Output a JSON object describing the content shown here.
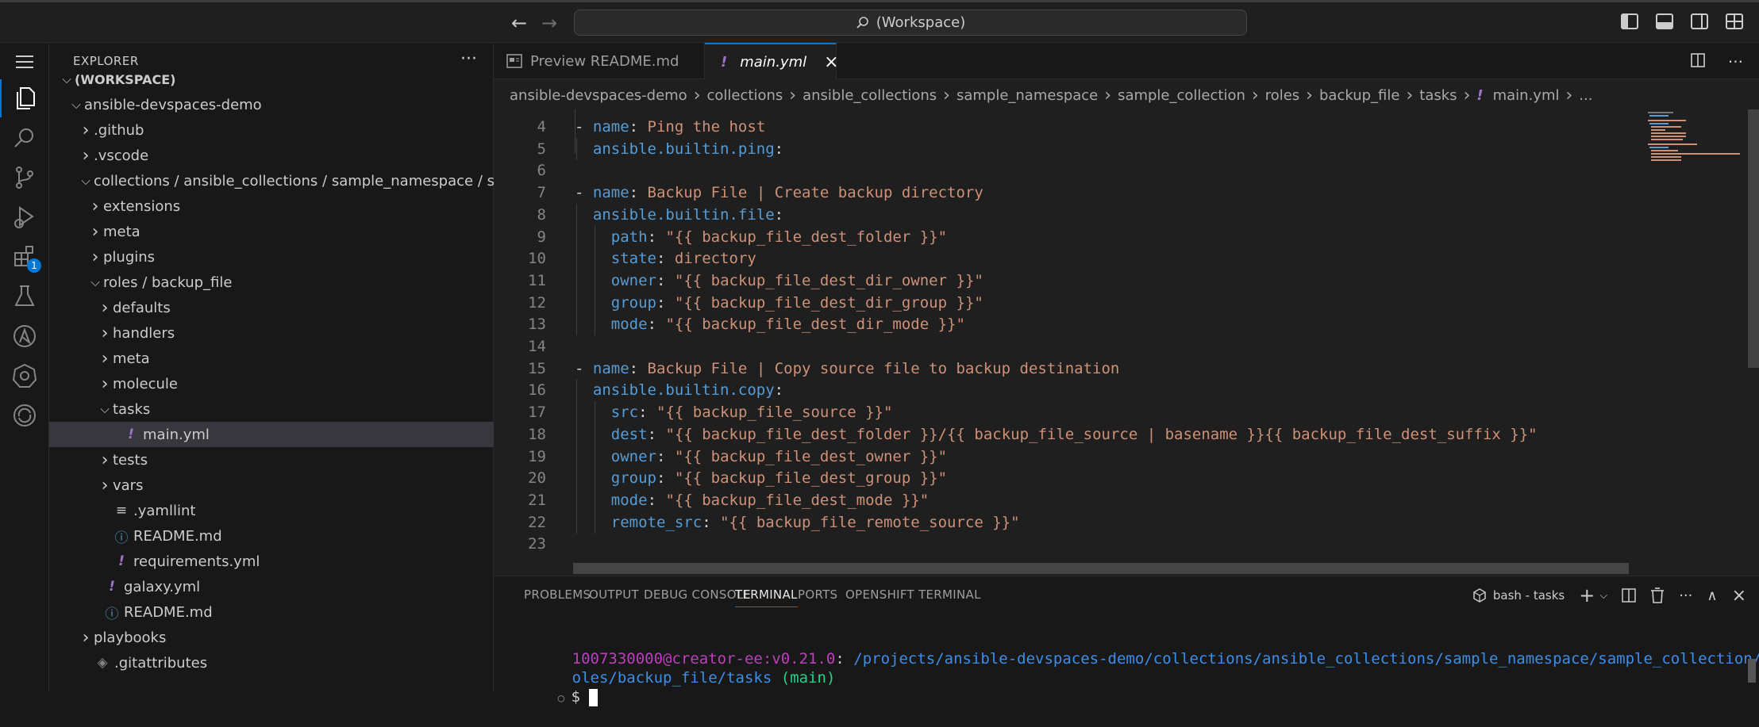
{
  "titlebar": {
    "search_label": "(Workspace)"
  },
  "activity_bar": {
    "extensions_badge": "1"
  },
  "explorer": {
    "title": "EXPLORER",
    "more": "···",
    "tree": [
      {
        "label": "(WORKSPACE)",
        "depth": 0,
        "type": "folder-open",
        "bold": true
      },
      {
        "label": "ansible-devspaces-demo",
        "depth": 1,
        "type": "folder-open"
      },
      {
        "label": ".github",
        "depth": 2,
        "type": "folder"
      },
      {
        "label": ".vscode",
        "depth": 2,
        "type": "folder"
      },
      {
        "label": "collections / ansible_collections / sample_namespace / sa...",
        "depth": 2,
        "type": "folder-open"
      },
      {
        "label": "extensions",
        "depth": 3,
        "type": "folder"
      },
      {
        "label": "meta",
        "depth": 3,
        "type": "folder"
      },
      {
        "label": "plugins",
        "depth": 3,
        "type": "folder"
      },
      {
        "label": "roles / backup_file",
        "depth": 3,
        "type": "folder-open"
      },
      {
        "label": "defaults",
        "depth": 4,
        "type": "folder"
      },
      {
        "label": "handlers",
        "depth": 4,
        "type": "folder"
      },
      {
        "label": "meta",
        "depth": 4,
        "type": "folder"
      },
      {
        "label": "molecule",
        "depth": 4,
        "type": "folder"
      },
      {
        "label": "tasks",
        "depth": 4,
        "type": "folder-open"
      },
      {
        "label": "main.yml",
        "depth": 5,
        "type": "yaml",
        "selected": true
      },
      {
        "label": "tests",
        "depth": 4,
        "type": "folder"
      },
      {
        "label": "vars",
        "depth": 4,
        "type": "folder"
      },
      {
        "label": ".yamllint",
        "depth": 4,
        "type": "lines"
      },
      {
        "label": "README.md",
        "depth": 4,
        "type": "info"
      },
      {
        "label": "requirements.yml",
        "depth": 4,
        "type": "yaml"
      },
      {
        "label": "galaxy.yml",
        "depth": 3,
        "type": "yaml"
      },
      {
        "label": "README.md",
        "depth": 3,
        "type": "info"
      },
      {
        "label": "playbooks",
        "depth": 2,
        "type": "folder"
      },
      {
        "label": ".gitattributes",
        "depth": 2,
        "type": "git"
      }
    ]
  },
  "tabs": [
    {
      "label": "Preview README.md",
      "active": false
    },
    {
      "label": "main.yml",
      "active": true,
      "close": "×"
    }
  ],
  "breadcrumb": [
    "ansible-devspaces-demo",
    "collections",
    "ansible_collections",
    "sample_namespace",
    "sample_collection",
    "roles",
    "backup_file",
    "tasks",
    "main.yml",
    "..."
  ],
  "code": [
    {
      "n": "4",
      "indent": 0,
      "parts": [
        [
          "d",
          "- "
        ],
        [
          "k",
          "name"
        ],
        [
          "d",
          ": "
        ],
        [
          "s",
          "Ping the host"
        ]
      ]
    },
    {
      "n": "5",
      "indent": 1,
      "parts": [
        [
          "k",
          "ansible.builtin.ping"
        ],
        [
          "d",
          ":"
        ]
      ]
    },
    {
      "n": "6",
      "indent": 0,
      "parts": []
    },
    {
      "n": "7",
      "indent": 0,
      "parts": [
        [
          "d",
          "- "
        ],
        [
          "k",
          "name"
        ],
        [
          "d",
          ": "
        ],
        [
          "s",
          "Backup File | Create backup directory"
        ]
      ]
    },
    {
      "n": "8",
      "indent": 1,
      "parts": [
        [
          "k",
          "ansible.builtin.file"
        ],
        [
          "d",
          ":"
        ]
      ]
    },
    {
      "n": "9",
      "indent": 2,
      "parts": [
        [
          "k",
          "path"
        ],
        [
          "d",
          ": "
        ],
        [
          "s",
          "\"{{ backup_file_dest_folder }}\""
        ]
      ]
    },
    {
      "n": "10",
      "indent": 2,
      "parts": [
        [
          "k",
          "state"
        ],
        [
          "d",
          ": "
        ],
        [
          "s",
          "directory"
        ]
      ]
    },
    {
      "n": "11",
      "indent": 2,
      "parts": [
        [
          "k",
          "owner"
        ],
        [
          "d",
          ": "
        ],
        [
          "s",
          "\"{{ backup_file_dest_dir_owner }}\""
        ]
      ]
    },
    {
      "n": "12",
      "indent": 2,
      "parts": [
        [
          "k",
          "group"
        ],
        [
          "d",
          ": "
        ],
        [
          "s",
          "\"{{ backup_file_dest_dir_group }}\""
        ]
      ]
    },
    {
      "n": "13",
      "indent": 2,
      "parts": [
        [
          "k",
          "mode"
        ],
        [
          "d",
          ": "
        ],
        [
          "s",
          "\"{{ backup_file_dest_dir_mode }}\""
        ]
      ]
    },
    {
      "n": "14",
      "indent": 0,
      "parts": []
    },
    {
      "n": "15",
      "indent": 0,
      "parts": [
        [
          "d",
          "- "
        ],
        [
          "k",
          "name"
        ],
        [
          "d",
          ": "
        ],
        [
          "s",
          "Backup File | Copy source file to backup destination"
        ]
      ]
    },
    {
      "n": "16",
      "indent": 1,
      "parts": [
        [
          "k",
          "ansible.builtin.copy"
        ],
        [
          "d",
          ":"
        ]
      ]
    },
    {
      "n": "17",
      "indent": 2,
      "parts": [
        [
          "k",
          "src"
        ],
        [
          "d",
          ": "
        ],
        [
          "s",
          "\"{{ backup_file_source }}\""
        ]
      ]
    },
    {
      "n": "18",
      "indent": 2,
      "parts": [
        [
          "k",
          "dest"
        ],
        [
          "d",
          ": "
        ],
        [
          "s",
          "\"{{ backup_file_dest_folder }}/{{ backup_file_source | basename }}{{ backup_file_dest_suffix }}\""
        ]
      ]
    },
    {
      "n": "19",
      "indent": 2,
      "parts": [
        [
          "k",
          "owner"
        ],
        [
          "d",
          ": "
        ],
        [
          "s",
          "\"{{ backup_file_dest_owner }}\""
        ]
      ]
    },
    {
      "n": "20",
      "indent": 2,
      "parts": [
        [
          "k",
          "group"
        ],
        [
          "d",
          ": "
        ],
        [
          "s",
          "\"{{ backup_file_dest_group }}\""
        ]
      ]
    },
    {
      "n": "21",
      "indent": 2,
      "parts": [
        [
          "k",
          "mode"
        ],
        [
          "d",
          ": "
        ],
        [
          "s",
          "\"{{ backup_file_dest_mode }}\""
        ]
      ]
    },
    {
      "n": "22",
      "indent": 2,
      "parts": [
        [
          "k",
          "remote_src"
        ],
        [
          "d",
          ": "
        ],
        [
          "s",
          "\"{{ backup_file_remote_source }}\""
        ]
      ]
    },
    {
      "n": "23",
      "indent": 0,
      "parts": []
    }
  ],
  "panel": {
    "tabs": [
      "PROBLEMS",
      "OUTPUT",
      "DEBUG CONSOLE",
      "TERMINAL",
      "PORTS",
      "OPENSHIFT TERMINAL"
    ],
    "active_tab": "TERMINAL",
    "terminal_name": "bash - tasks",
    "terminal": {
      "user": "1007330000",
      "host": "@creator-ee:v0.21.0",
      "colon": ":",
      "path_line1": " /projects/ansible-devspaces-demo/collections/ansible_collections/sample_namespace/sample_collection/r",
      "path_line2": "oles/backup_file/tasks",
      "branch": " (main)",
      "prompt": "$"
    }
  },
  "colors": {
    "accent": "#0078d4",
    "keyword": "#569cd6",
    "string": "#ce9178",
    "terminal_user": "#bc3fbc",
    "terminal_path": "#3b8eea",
    "terminal_branch": "#23d18b"
  }
}
